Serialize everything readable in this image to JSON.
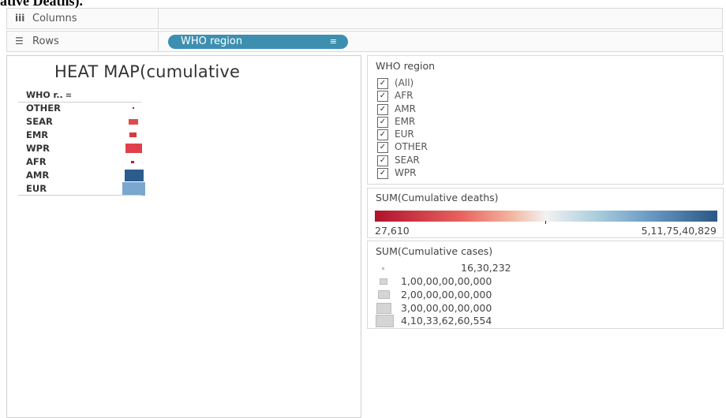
{
  "caption": "ative Deaths).",
  "columns_shelf": {
    "icon": "columns-icon",
    "label": "Columns"
  },
  "rows_shelf": {
    "icon": "rows-icon",
    "label": "Rows",
    "pill": "WHO region"
  },
  "viz": {
    "title": "HEAT MAP(cumulative",
    "column_header": "WHO r..",
    "rows": [
      {
        "label": "OTHER",
        "color": "#c8102e"
      },
      {
        "label": "SEAR",
        "color": "#e04a4a"
      },
      {
        "label": "EMR",
        "color": "#d63a3a"
      },
      {
        "label": "WPR",
        "color": "#e0404a"
      },
      {
        "label": "AFR",
        "color": "#c8102e"
      },
      {
        "label": "AMR",
        "color": "#2c5c8c"
      },
      {
        "label": "EUR",
        "color": "#7aa7cf"
      }
    ]
  },
  "filter_card": {
    "title": "WHO region",
    "items": [
      "(All)",
      "AFR",
      "AMR",
      "EMR",
      "EUR",
      "OTHER",
      "SEAR",
      "WPR"
    ]
  },
  "color_legend": {
    "title": "SUM(Cumulative deaths)",
    "min_label": "27,610",
    "max_label": "5,11,75,40,829"
  },
  "size_legend": {
    "title": "SUM(Cumulative cases)",
    "items": [
      "16,30,232",
      "1,00,00,00,00,000",
      "2,00,00,00,00,000",
      "3,00,00,00,00,000",
      "4,10,33,62,60,554"
    ]
  }
}
